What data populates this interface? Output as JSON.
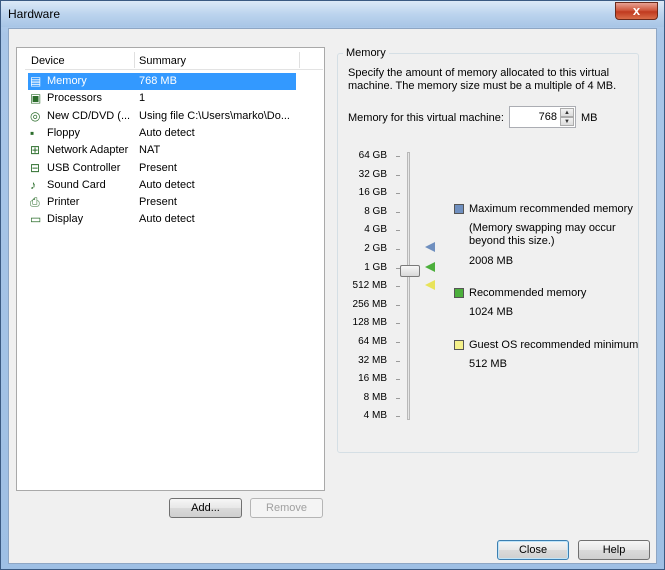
{
  "window": {
    "title": "Hardware",
    "close_glyph": "x"
  },
  "device_list": {
    "columns": [
      "Device",
      "Summary"
    ],
    "rows": [
      {
        "device": "Memory",
        "summary": "768 MB",
        "icon": "memory-icon",
        "selected": true
      },
      {
        "device": "Processors",
        "summary": "1",
        "icon": "processor-icon"
      },
      {
        "device": "New CD/DVD (...",
        "summary": "Using file C:\\Users\\marko\\Do...",
        "icon": "cd-dvd-icon"
      },
      {
        "device": "Floppy",
        "summary": "Auto detect",
        "icon": "floppy-icon"
      },
      {
        "device": "Network Adapter",
        "summary": "NAT",
        "icon": "network-adapter-icon"
      },
      {
        "device": "USB Controller",
        "summary": "Present",
        "icon": "usb-icon"
      },
      {
        "device": "Sound Card",
        "summary": "Auto detect",
        "icon": "sound-card-icon"
      },
      {
        "device": "Printer",
        "summary": "Present",
        "icon": "printer-icon"
      },
      {
        "device": "Display",
        "summary": "Auto detect",
        "icon": "display-icon"
      }
    ]
  },
  "buttons": {
    "add": "Add...",
    "remove": "Remove",
    "close": "Close",
    "help": "Help"
  },
  "memory": {
    "group_title": "Memory",
    "description": "Specify the amount of memory allocated to this virtual machine. The memory size must be a multiple of 4 MB.",
    "field_label": "Memory for this virtual machine:",
    "value": "768",
    "unit": "MB",
    "scale": [
      "64 GB",
      "32 GB",
      "16 GB",
      "8 GB",
      "4 GB",
      "2 GB",
      "1 GB",
      "512 MB",
      "256 MB",
      "128 MB",
      "64 MB",
      "32 MB",
      "16 MB",
      "8 MB",
      "4 MB"
    ],
    "legend": {
      "max_title": "Maximum recommended memory",
      "max_note": "(Memory swapping may occur beyond this size.)",
      "max_value": "2008 MB",
      "rec_title": "Recommended memory",
      "rec_value": "1024 MB",
      "min_title": "Guest OS recommended minimum",
      "min_value": "512 MB"
    },
    "colors": {
      "max": "#6f8fbf",
      "rec": "#4caf3c",
      "min": "#f4f08a"
    }
  }
}
